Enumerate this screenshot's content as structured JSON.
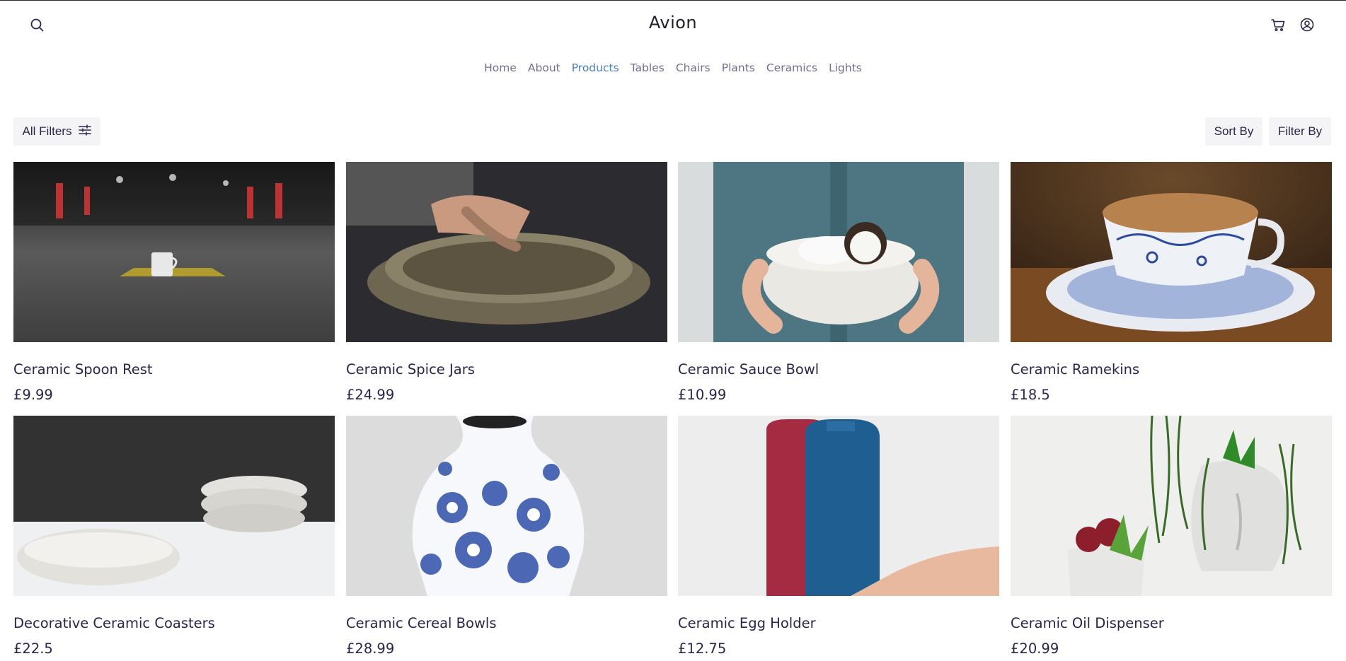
{
  "brand": "Avion",
  "header": {
    "search_icon": "search-icon",
    "cart_icon": "cart-icon",
    "account_icon": "user-circle-icon"
  },
  "nav": {
    "items": [
      {
        "label": "Home",
        "active": false
      },
      {
        "label": "About",
        "active": false
      },
      {
        "label": "Products",
        "active": true
      },
      {
        "label": "Tables",
        "active": false
      },
      {
        "label": "Chairs",
        "active": false
      },
      {
        "label": "Plants",
        "active": false
      },
      {
        "label": "Ceramics",
        "active": false
      },
      {
        "label": "Lights",
        "active": false
      }
    ]
  },
  "toolbar": {
    "all_filters": "All Filters",
    "sort_by": "Sort By",
    "filter_by": "Filter By"
  },
  "products": [
    {
      "name": "Ceramic Spoon Rest",
      "price": "£9.99"
    },
    {
      "name": "Ceramic Spice Jars",
      "price": "£24.99"
    },
    {
      "name": "Ceramic Sauce Bowl",
      "price": "£10.99"
    },
    {
      "name": "Ceramic Ramekins",
      "price": "£18.5"
    },
    {
      "name": "Decorative Ceramic Coasters",
      "price": "£22.5"
    },
    {
      "name": "Ceramic Cereal Bowls",
      "price": "£28.99"
    },
    {
      "name": "Ceramic Egg Holder",
      "price": "£12.75"
    },
    {
      "name": "Ceramic Oil Dispenser",
      "price": "£20.99"
    }
  ],
  "colors": {
    "text": "#2A254B",
    "nav": "#726E8D",
    "active_nav": "#4A7DC9",
    "button_bg": "#F4F4F6"
  }
}
